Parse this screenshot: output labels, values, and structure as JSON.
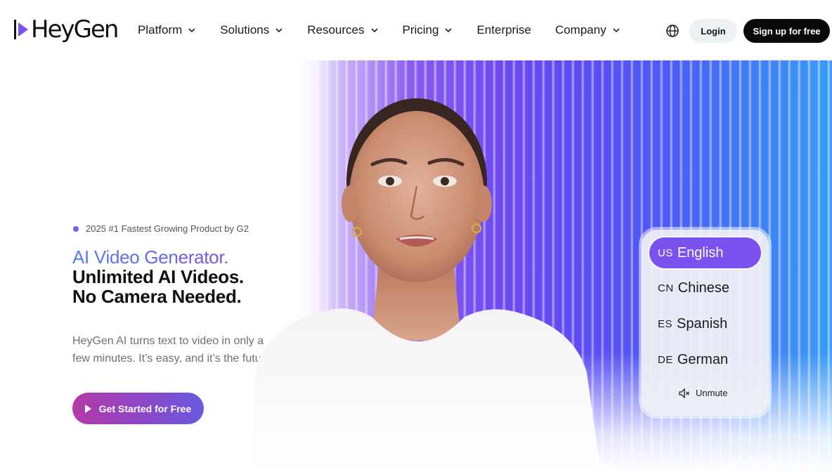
{
  "brand": {
    "name": "HeyGen"
  },
  "nav": {
    "items": [
      {
        "label": "Platform",
        "has_dropdown": true
      },
      {
        "label": "Solutions",
        "has_dropdown": true
      },
      {
        "label": "Resources",
        "has_dropdown": true
      },
      {
        "label": "Pricing",
        "has_dropdown": true
      },
      {
        "label": "Enterprise",
        "has_dropdown": false
      },
      {
        "label": "Company",
        "has_dropdown": true
      }
    ],
    "language_icon": "globe-icon",
    "login_label": "Login",
    "signup_label": "Sign up for free"
  },
  "hero": {
    "badge": "2025 #1 Fastest Growing Product by G2",
    "headline_accent": "AI Video Generator.",
    "headline_line2": "Unlimited AI Videos.",
    "headline_line3": "No Camera Needed.",
    "subtext": "HeyGen AI turns text to video in only a few minutes. It’s easy, and it’s the future.",
    "cta_label": "Get Started for Free"
  },
  "language_selector": {
    "selected": "English",
    "options": [
      {
        "code": "US",
        "label": "English"
      },
      {
        "code": "CN",
        "label": "Chinese"
      },
      {
        "code": "ES",
        "label": "Spanish"
      },
      {
        "code": "DE",
        "label": "German"
      }
    ],
    "unmute_label": "Unmute",
    "unmute_icon": "speaker-muted-icon"
  },
  "colors": {
    "accent_purple": "#7a52ef",
    "cta_gradient_start": "#b33aa8",
    "cta_gradient_end": "#6a5ae0",
    "signup_bg": "#0a0a0a"
  }
}
